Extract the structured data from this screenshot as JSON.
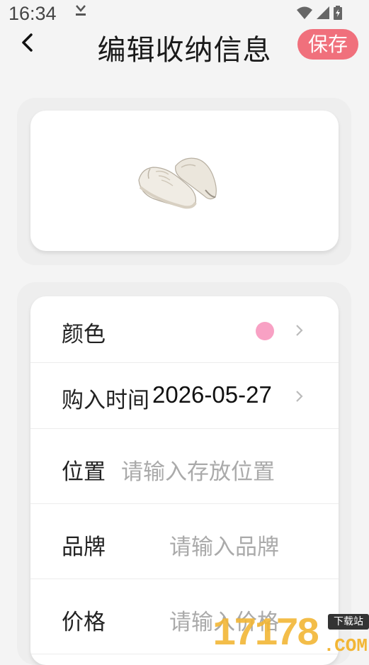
{
  "status_bar": {
    "time": "16:34"
  },
  "header": {
    "title": "编辑收纳信息",
    "save_label": "保存"
  },
  "form": {
    "color": {
      "label": "颜色",
      "value_color": "#f8a1c4"
    },
    "purchase_time": {
      "label": "购入时间",
      "value": "2026-05-27"
    },
    "location": {
      "label": "位置",
      "placeholder": "请输入存放位置"
    },
    "brand": {
      "label": "品牌",
      "placeholder": "请输入品牌"
    },
    "price": {
      "label": "价格",
      "placeholder": "请输入价格"
    }
  },
  "watermark": {
    "text": "17178",
    "suffix": ".COM",
    "badge": "下载站"
  },
  "colors": {
    "accent": "#f0707c",
    "placeholder": "#aaaaaa"
  }
}
